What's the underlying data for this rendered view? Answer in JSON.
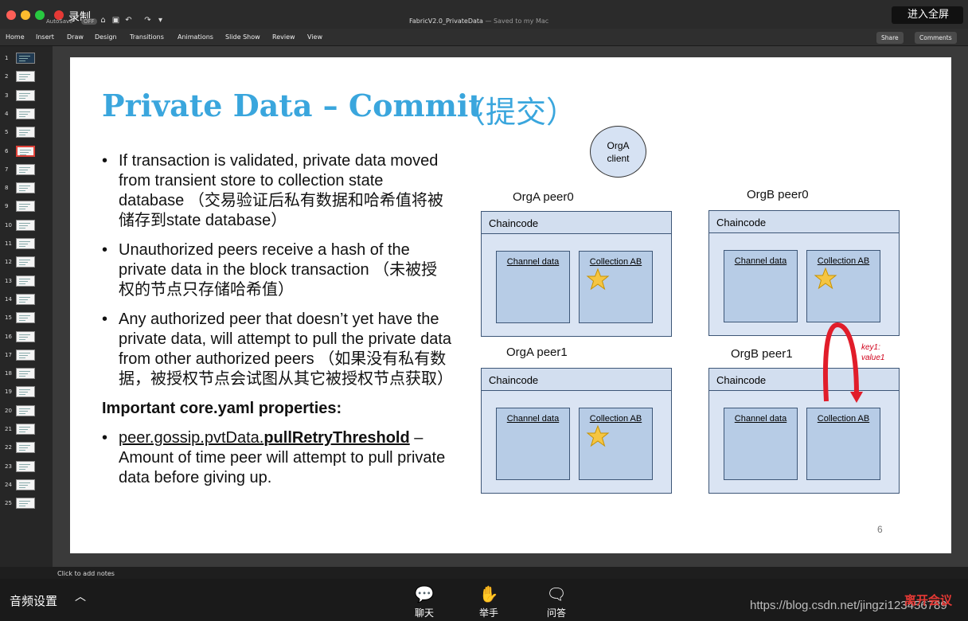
{
  "titlebar": {
    "recording_label": "录制",
    "autosave_label": "AutoSave",
    "autosave_state": "OFF",
    "document_name": "FabricV2.0_PrivateData",
    "save_status": "— Saved to my Mac",
    "fullscreen_label": "进入全屏"
  },
  "ribbon": {
    "tabs": [
      "Home",
      "Insert",
      "Draw",
      "Design",
      "Transitions",
      "Animations",
      "Slide Show",
      "Review",
      "View"
    ],
    "share_label": "Share",
    "comments_label": "Comments"
  },
  "thumbnails": {
    "numbers": [
      "1",
      "2",
      "3",
      "4",
      "5",
      "6",
      "7",
      "8",
      "9",
      "10",
      "11",
      "12",
      "13",
      "14",
      "15",
      "16",
      "17",
      "18",
      "19",
      "20",
      "21",
      "22",
      "23",
      "24",
      "25"
    ],
    "selected": "6"
  },
  "slide": {
    "title": "Private Data – Commit",
    "title_cn": "（提交）",
    "bullets": [
      "If transaction is validated, private data moved from transient store to collection state database （交易验证后私有数据和哈希值将被储存到state database）",
      "Unauthorized peers receive a hash of the private data in the block transaction （未被授权的节点只存储哈希值）",
      "Any authorized peer that doesn’t yet have the private data, will attempt to pull the private data from other authorized peers （如果没有私有数据，被授权节点会试图从其它被授权节点获取）"
    ],
    "important_heading": "Important core.yaml properties:",
    "property_prefix": "peer.gossip.pvtData.",
    "property_name": "pullRetryThreshold",
    "property_desc": " – Amount of time peer will attempt to pull private data before giving up.",
    "page_number": "6",
    "diagram": {
      "client_line1": "OrgA",
      "client_line2": "client",
      "peers": [
        {
          "label": "OrgA peer0",
          "chaincode": "Chaincode",
          "left_box": "Channel data",
          "right_box": "Collection AB"
        },
        {
          "label": "OrgB peer0",
          "chaincode": "Chaincode",
          "left_box": "Channel data",
          "right_box": "Collection AB"
        },
        {
          "label": "OrgA peer1",
          "chaincode": "Chaincode",
          "left_box": "Channel data",
          "right_box": "Collection AB"
        },
        {
          "label": "OrgB peer1",
          "chaincode": "Chaincode",
          "left_box": "Channel data",
          "right_box": "Collection AB"
        }
      ],
      "annotation_line1": "key1:",
      "annotation_line2": "value1",
      "accent_color": "#d0021b"
    }
  },
  "notes_placeholder": "Click to add notes",
  "meeting": {
    "audio_settings": "音频设置",
    "chat": "聊天",
    "raise_hand": "举手",
    "qa": "问答",
    "leave": "离开会议",
    "watermark": "https://blog.csdn.net/jingzi123456789"
  }
}
